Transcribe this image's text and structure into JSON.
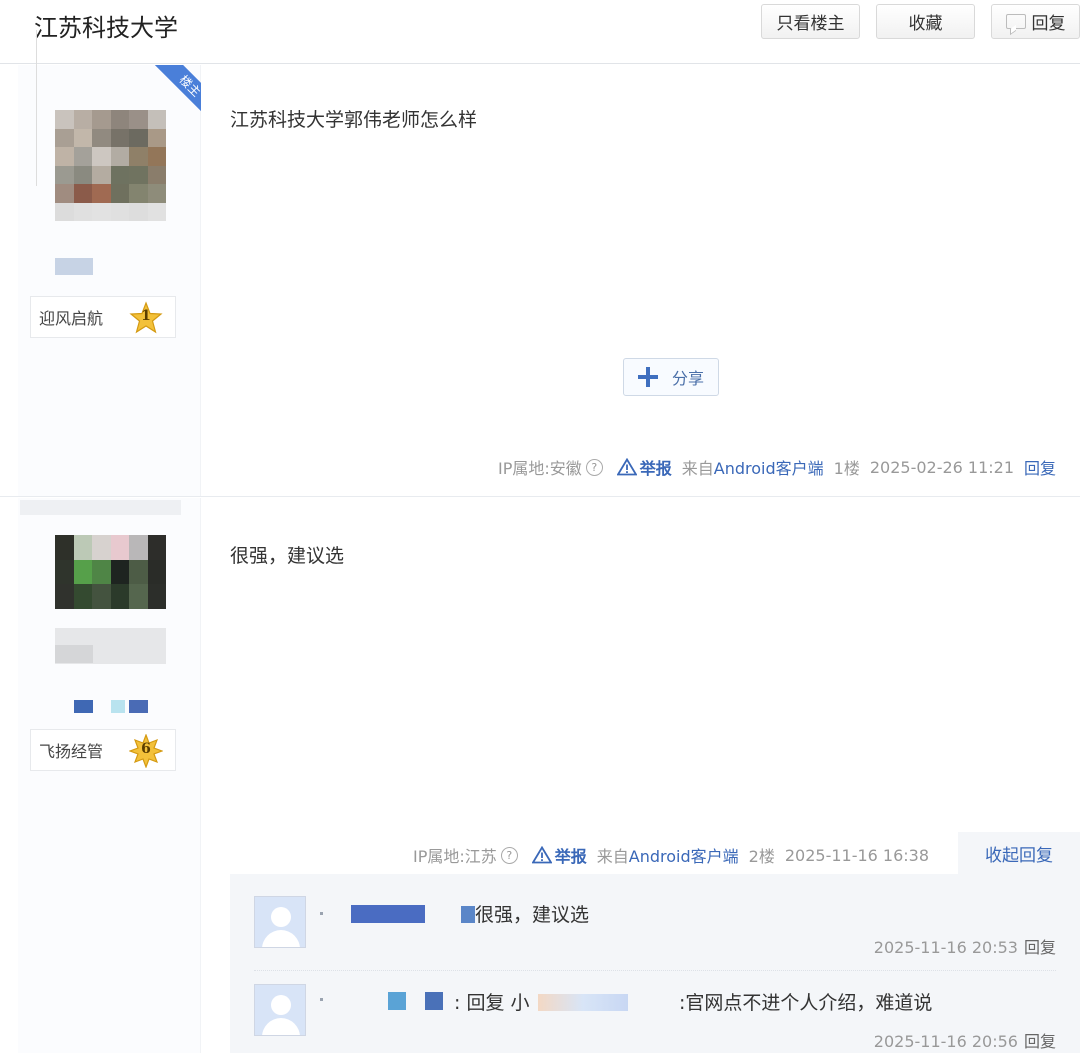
{
  "header": {
    "title": "江苏科技大学",
    "buttons": {
      "only_owner": "只看楼主",
      "favorite": "收藏",
      "reply": "回复"
    }
  },
  "posts": [
    {
      "owner_tag": "楼主",
      "user": {
        "badge_name": "迎风启航",
        "level": "1"
      },
      "content": "江苏科技大学郭伟老师怎么样",
      "share_label": "分享",
      "meta": {
        "ip": "IP属地:安徽",
        "report": "举报",
        "source_prefix": "来自",
        "source_client": "Android客户端",
        "floor": "1楼",
        "time": "2025-02-26 11:21",
        "reply": "回复"
      }
    },
    {
      "user": {
        "badge_name": "飞扬经管",
        "level": "6"
      },
      "content": "很强，建议选",
      "meta": {
        "ip": "IP属地:江苏",
        "report": "举报",
        "source_prefix": "来自",
        "source_client": "Android客户端",
        "floor": "2楼",
        "time": "2025-11-16 16:38",
        "collapse": "收起回复"
      },
      "comments": [
        {
          "text": "很强，建议选",
          "time": "2025-11-16 20:53",
          "reply": "回复"
        },
        {
          "text_reply_prefix": ": 回复 小",
          "text_tail": ":官网点不进个人介绍，难道说",
          "time": "2025-11-16 20:56",
          "reply": "回复"
        }
      ]
    }
  ],
  "colors": {
    "link": "#3a68b8",
    "meta": "#999999",
    "ribbon": "#4a7fd9",
    "star": "#f3c13a"
  },
  "icons": [
    "reply-icon",
    "plus-icon",
    "help-icon",
    "warning-icon",
    "star-icon",
    "default-avatar-icon"
  ]
}
